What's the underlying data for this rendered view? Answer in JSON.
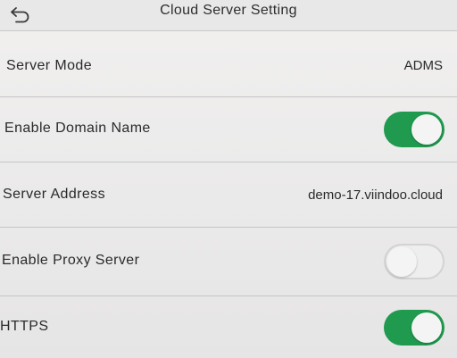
{
  "header": {
    "title": "Cloud Server Setting",
    "back_icon": "back-arrow-icon"
  },
  "rows": [
    {
      "label": "Server Mode",
      "value": "ADMS"
    },
    {
      "label": "Enable Domain Name",
      "toggle": "on"
    },
    {
      "label": "Server Address",
      "value": "demo-17.viindoo.cloud"
    },
    {
      "label": "Enable Proxy Server",
      "toggle": "off"
    },
    {
      "label": "HTTPS",
      "toggle": "on"
    }
  ],
  "colors": {
    "toggle_on": "#1f9a4e",
    "toggle_off": "#eeeeee",
    "background": "#ecebeb"
  }
}
